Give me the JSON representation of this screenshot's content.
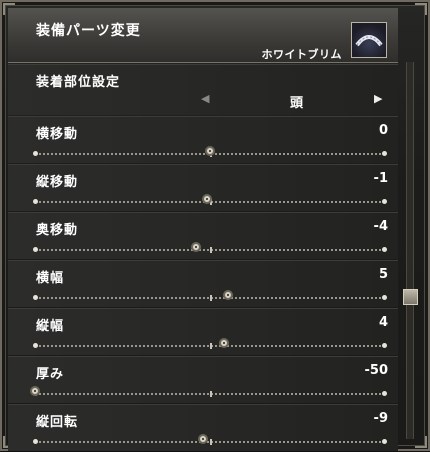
{
  "header": {
    "title": "装備パーツ変更",
    "item_name": "ホワイトブリム"
  },
  "part_selector": {
    "label": "装着部位設定",
    "value": "頭",
    "left_arrow": "◀",
    "right_arrow": "▶"
  },
  "sliders": [
    {
      "label": "横移動",
      "value": "0",
      "level": 0.5
    },
    {
      "label": "縦移動",
      "value": "-1",
      "level": 0.49
    },
    {
      "label": "奥移動",
      "value": "-4",
      "level": 0.46
    },
    {
      "label": "横幅",
      "value": "5",
      "level": 0.55
    },
    {
      "label": "縦幅",
      "value": "4",
      "level": 0.54
    },
    {
      "label": "厚み",
      "value": "-50",
      "level": 0.0
    },
    {
      "label": "縦回転",
      "value": "-9",
      "level": 0.48
    }
  ],
  "scrollbar": {
    "position": 0.63
  }
}
